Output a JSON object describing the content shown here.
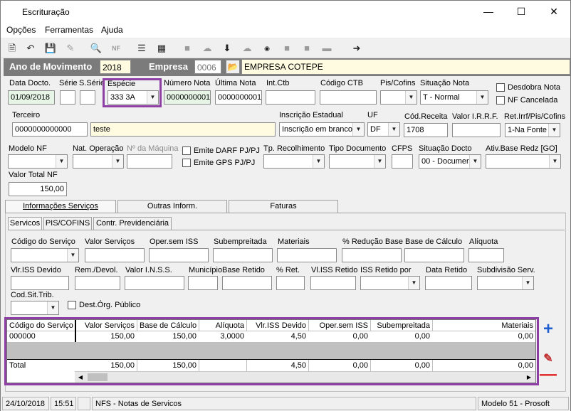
{
  "window": {
    "title": "Escrituração"
  },
  "menu": {
    "items": [
      "Opções",
      "Ferramentas",
      "Ajuda"
    ]
  },
  "toolbar": {
    "icons": [
      "new-icon",
      "undo-icon",
      "save-icon",
      "delete-icon",
      "preview-icon",
      "nfe-icon",
      "list-icon",
      "calc-icon",
      "folder-icon",
      "cloud-icon",
      "download-icon",
      "cloud2-icon",
      "cb-icon",
      "box-icon",
      "box2-icon",
      "bar-icon",
      "exit-icon"
    ]
  },
  "header": {
    "ano_label": "Ano de Movimento",
    "ano_value": "2018",
    "empresa_label": "Empresa",
    "empresa_code": "0006",
    "empresa_name": "EMPRESA COTEPE"
  },
  "form": {
    "data_docto_label": "Data Docto.",
    "data_docto": "01/09/2018",
    "serie_label": "Série",
    "serie": "",
    "sserie_label": "S.Série",
    "sserie": "",
    "especie_label": "Espécie",
    "especie": "333 3A",
    "numero_nota_label": "Número Nota",
    "numero_nota": "0000000001",
    "ultima_nota_label": "Última Nota",
    "ultima_nota": "0000000001",
    "int_ctb_label": "Int.Ctb",
    "int_ctb": "",
    "codigo_ctb_label": "Código CTB",
    "codigo_ctb": "",
    "pis_cofins_label": "Pis/Cofins",
    "pis_cofins": "",
    "situacao_nota_label": "Situação Nota",
    "situacao_nota": "T - Normal",
    "desdobra_label": "Desdobra Nota",
    "nf_cancelada_label": "NF Cancelada",
    "terceiro_label": "Terceiro",
    "terceiro_code": "0000000000000",
    "terceiro_name": "teste",
    "insc_estadual_label": "Inscrição Estadual",
    "insc_estadual": "Inscrição em branco",
    "uf_label": "UF",
    "uf": "DF",
    "cod_receita_label": "Cód.Receita",
    "cod_receita": "1708",
    "valor_irrf_label": "Valor I.R.R.F.",
    "valor_irrf": "",
    "ret_irrf_label": "Ret.Irrf/Pis/Cofins",
    "ret_irrf": "1-Na Fonte",
    "modelo_nf_label": "Modelo NF",
    "modelo_nf": "",
    "nat_operacao_label": "Nat. Operação",
    "nat_operacao": "",
    "no_maquina_label": "Nº da Máquina",
    "no_maquina": "",
    "emite_darf_label": "Emite DARF PJ/PJ",
    "emite_gps_label": "Emite GPS PJ/PJ",
    "tp_recolhimento_label": "Tp. Recolhimento",
    "tp_recolhimento": "",
    "tipo_documento_label": "Tipo Documento",
    "tipo_documento": "",
    "cfps_label": "CFPS",
    "cfps": "",
    "situacao_docto_label": "Situação Docto",
    "situacao_docto": "00 - Documer",
    "ativ_base_label": "Ativ.Base Redz [GO]",
    "ativ_base": "",
    "valor_total_label": "Valor Total NF",
    "valor_total": "150,00"
  },
  "tabs": {
    "main": [
      "Informações Serviços",
      "Outras Inform.",
      "Faturas"
    ],
    "sub": [
      "Servicos",
      "PIS/COFINS",
      "Contr. Previdenciária"
    ]
  },
  "servicos": {
    "codigo_servico_label": "Código do Serviço",
    "valor_servicos_label": "Valor Serviços",
    "oper_sem_iss_label": "Oper.sem ISS",
    "subempreitada_label": "Subempreitada",
    "materiais_label": "Materiais",
    "pct_reducao_label": "% Redução Base",
    "base_calculo_label": "Base de Cálculo",
    "aliquota_label": "Alíquota",
    "vlr_iss_devido_label": "Vlr.ISS Devido",
    "rem_devol_label": "Rem./Devol.",
    "valor_inss_label": "Valor I.N.S.S.",
    "municipio_label": "Município",
    "base_retido_label": "Base Retido",
    "pct_ret_label": "% Ret.",
    "vl_iss_retido_label": "Vl.ISS Retido",
    "iss_retido_por_label": "ISS Retido por",
    "data_retido_label": "Data Retido",
    "subdivisao_label": "Subdivisão Serv.",
    "cod_sit_trib_label": "Cod.Sit.Trib.",
    "dest_org_label": "Dest.Órg. Público"
  },
  "grid": {
    "columns": [
      "Código do Serviço",
      "Valor Serviços",
      "Base de Cálculo",
      "Alíquota",
      "Vlr.ISS Devido",
      "Oper.sem ISS",
      "Subempreitada",
      "Materiais"
    ],
    "row": [
      "000000",
      "150,00",
      "150,00",
      "3,0000",
      "4,50",
      "0,00",
      "0,00",
      "0,00"
    ],
    "total": [
      "Total",
      "150,00",
      "150,00",
      "",
      "4,50",
      "0,00",
      "0,00",
      "0,00"
    ]
  },
  "status": {
    "date": "24/10/2018",
    "time": "15:51",
    "empty": "",
    "module": "NFS - Notas de Servicos",
    "model": "Modelo 51 - Prosoft"
  },
  "colors": {
    "highlight": "#8e3fa3",
    "header_bg": "#7b7b7b",
    "add_btn": "#1f5fd1",
    "remove_btn": "#e02020"
  }
}
